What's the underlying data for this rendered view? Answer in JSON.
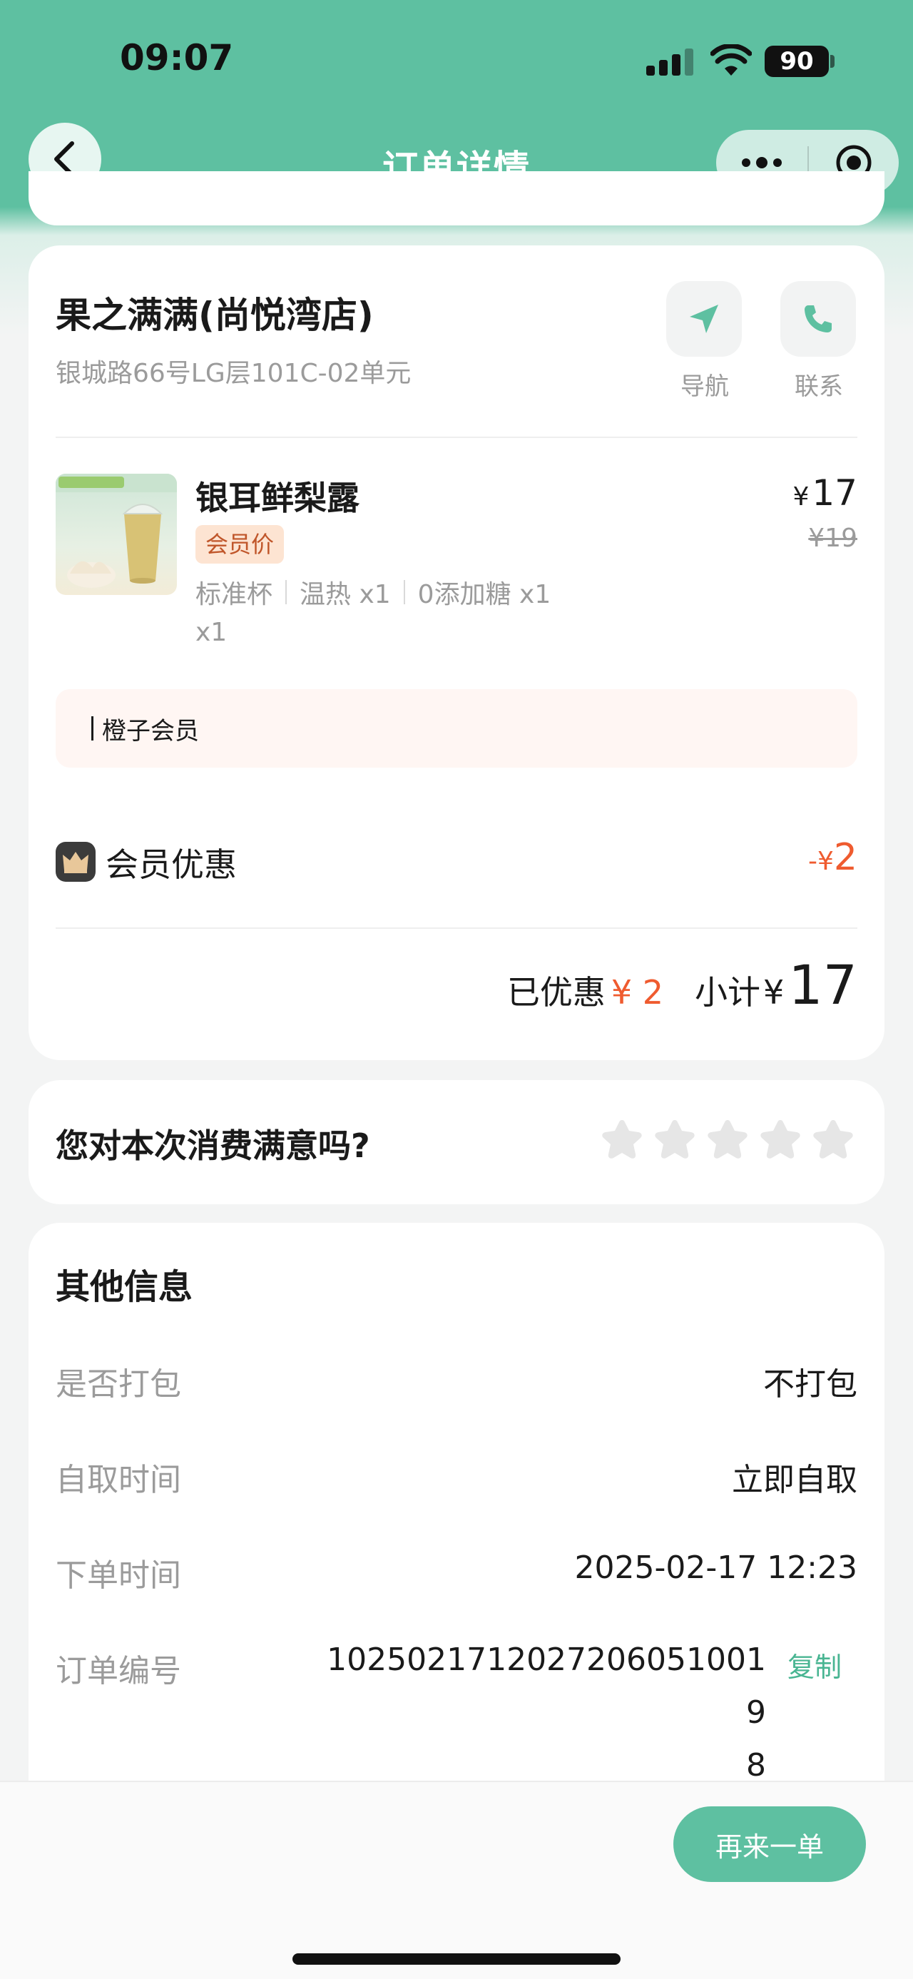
{
  "status_bar": {
    "time": "09:07",
    "battery": "90"
  },
  "nav": {
    "title": "订单详情"
  },
  "store": {
    "name": "果之满满(尚悦湾店)",
    "address": "银城路66号LG层101C-02单元",
    "navigate_label": "导航",
    "contact_label": "联系"
  },
  "product": {
    "name": "银耳鲜梨露",
    "tag": "会员价",
    "specs": [
      "标准杯",
      "温热 x1",
      "0添加糖 x1"
    ],
    "quantity": "x1",
    "price_symbol": "¥",
    "price": "17",
    "original_price": "¥19"
  },
  "member_note": "橙子会员",
  "discount": {
    "label": "会员优惠",
    "sign": "-",
    "symbol": "¥",
    "amount": "2"
  },
  "totals": {
    "saved_label": "已优惠",
    "saved_amount": "¥ 2",
    "subtotal_label": "小计",
    "subtotal_symbol": "¥",
    "subtotal_amount": "17"
  },
  "rating": {
    "question": "您对本次消费满意吗?",
    "stars": 5,
    "value": 0
  },
  "info": {
    "title": "其他信息",
    "rows": [
      {
        "label": "是否打包",
        "value": "不打包"
      },
      {
        "label": "自取时间",
        "value": "立即自取"
      },
      {
        "label": "下单时间",
        "value": "2025-02-17 12:23"
      },
      {
        "label": "订单编号",
        "value": "10250217120272060510019\n8"
      }
    ],
    "copy_label": "复制"
  },
  "bottom": {
    "reorder_label": "再来一单"
  },
  "colors": {
    "brand": "#5ec0a1",
    "discount": "#ef5b2f",
    "copy": "#49b592"
  }
}
